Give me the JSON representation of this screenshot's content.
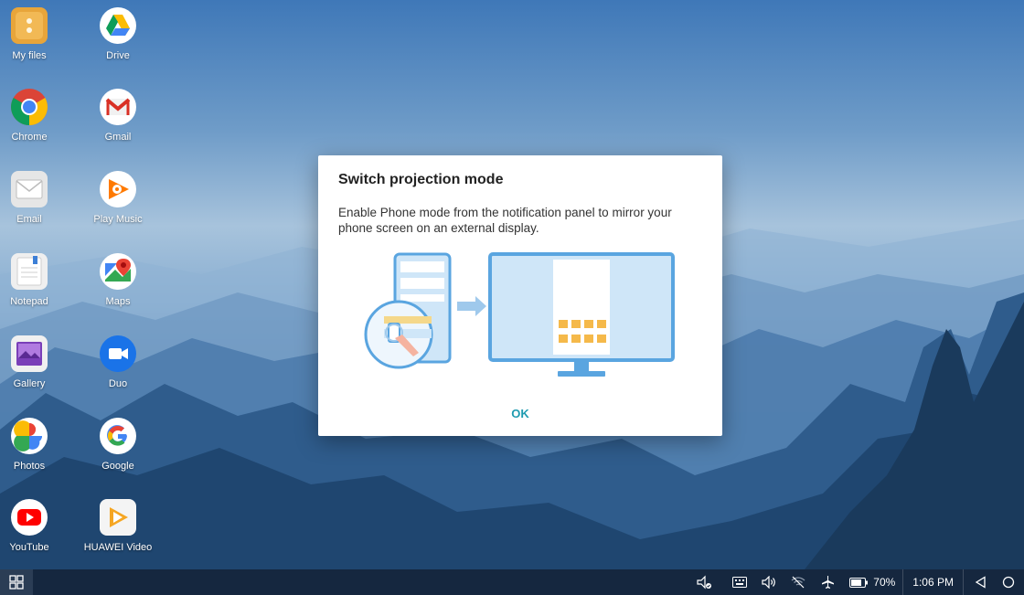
{
  "desktop": {
    "icons": [
      {
        "label": "My files",
        "icon": "folder-icon"
      },
      {
        "label": "Drive",
        "icon": "drive-icon"
      },
      {
        "label": "Chrome",
        "icon": "chrome-icon"
      },
      {
        "label": "Gmail",
        "icon": "gmail-icon"
      },
      {
        "label": "Email",
        "icon": "email-icon"
      },
      {
        "label": "Play Music",
        "icon": "play-music-icon"
      },
      {
        "label": "Notepad",
        "icon": "notepad-icon"
      },
      {
        "label": "Maps",
        "icon": "maps-icon"
      },
      {
        "label": "Gallery",
        "icon": "gallery-icon"
      },
      {
        "label": "Duo",
        "icon": "duo-icon"
      },
      {
        "label": "Photos",
        "icon": "photos-icon"
      },
      {
        "label": "Google",
        "icon": "google-icon"
      },
      {
        "label": "YouTube",
        "icon": "youtube-icon"
      },
      {
        "label": "HUAWEI Video",
        "icon": "huawei-video-icon"
      }
    ]
  },
  "dialog": {
    "title": "Switch projection mode",
    "body": "Enable Phone mode from the notification panel to mirror your phone screen on an external display.",
    "ok_label": "OK"
  },
  "taskbar": {
    "battery": "70%",
    "time": "1:06 PM"
  },
  "colors": {
    "accent": "#1f9bb0",
    "taskbar": "#15273f",
    "illustration_blue": "#5aa5e0",
    "illustration_light": "#cfe6f8",
    "illustration_orange": "#f5b94a"
  }
}
